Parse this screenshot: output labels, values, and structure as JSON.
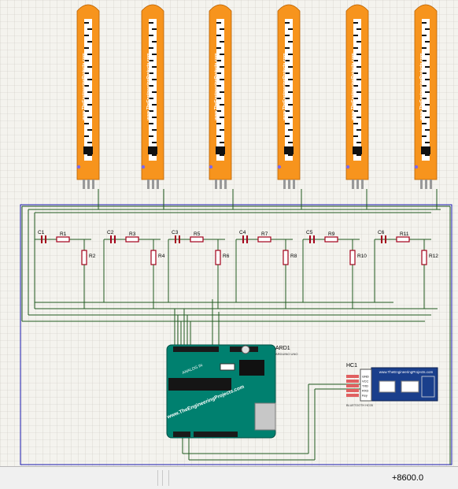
{
  "sensors": [
    {
      "label": "www.TheEngineeringProjects.com"
    },
    {
      "label": "www.TheEngineeringProjects.com"
    },
    {
      "label": "www.TheEngineeringProjects.com"
    },
    {
      "label": "www.TheEngineeringProjects.com"
    },
    {
      "label": "www.TheEngineeringProjects.com"
    },
    {
      "label": "www.TheEngineeringProjects.com"
    }
  ],
  "filters": [
    {
      "cap": "C1",
      "r_series": "R1",
      "r_shunt": "R2"
    },
    {
      "cap": "C2",
      "r_series": "R3",
      "r_shunt": "R4"
    },
    {
      "cap": "C3",
      "r_series": "R5",
      "r_shunt": "R6"
    },
    {
      "cap": "C4",
      "r_series": "R7",
      "r_shunt": "R8"
    },
    {
      "cap": "C5",
      "r_series": "R9",
      "r_shunt": "R10"
    },
    {
      "cap": "C6",
      "r_series": "R11",
      "r_shunt": "R12"
    }
  ],
  "arduino": {
    "ref": "ARD1",
    "part": "ARDUINO UNO",
    "site": "www.TheEngineeringProjects.com",
    "analog": "ANALOG IN"
  },
  "bluetooth": {
    "ref": "HC1",
    "site": "www.TheEngineeringProjects.com",
    "part": "BLUETOOTH HC05",
    "pins": [
      "GND",
      "VCC",
      "TXD",
      "RXD",
      "Key"
    ]
  },
  "status": {
    "coordinate": "+8600.0"
  },
  "colors": {
    "wire": "#1f5a1f",
    "sensor": "#f7941d",
    "resistor": "#a4001b",
    "board": "#00806f",
    "frame": "#1a1ab0"
  }
}
